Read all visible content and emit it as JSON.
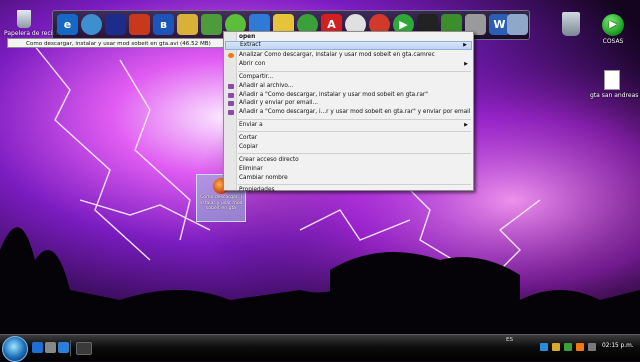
{
  "desktop": {
    "recycle_bin_label": "Papelera de reciclaje",
    "cosas_label": "COSAS",
    "gta_icon_label": "gta san andreas",
    "selected_file_label": "Como descargar, instalar y usar mod sobeit en gta"
  },
  "tooltip": {
    "text": "Como descargar, instalar y usar mod sobeit en gta.avi (46.52 MB)"
  },
  "context_menu": {
    "items": [
      {
        "label": "open",
        "bold": true
      },
      {
        "label": "Extract",
        "submenu": true,
        "highlighted": true
      },
      {
        "label": "Analizar Como descargar, instalar y usar mod sobeit en gta.camrec",
        "icon": "avast-icon"
      },
      {
        "label": "Abrir con",
        "submenu": true
      },
      {
        "label": "Compartir..."
      },
      {
        "label": "Añadir al archivo...",
        "icon": "winrar-icon"
      },
      {
        "label": "Añadir a \"Como descargar, instalar y usar mod sobeit en gta.rar\"",
        "icon": "winrar-icon"
      },
      {
        "label": "Añadir y enviar por email...",
        "icon": "winrar-icon"
      },
      {
        "label": "Añadir a \"Como descargar, i...r y usar mod sobeit en gta.rar\" y enviar por email",
        "icon": "winrar-icon"
      },
      {
        "label": "Enviar a",
        "submenu": true
      },
      {
        "label": "Cortar"
      },
      {
        "label": "Copiar"
      },
      {
        "label": "Crear acceso directo"
      },
      {
        "label": "Eliminar"
      },
      {
        "label": "Cambiar nombre"
      },
      {
        "label": "Propiedades"
      }
    ]
  },
  "taskbar": {
    "language": "ES",
    "clock": "02:15 p.m."
  },
  "colors": {
    "menu_bg": "#f1f1f1",
    "highlight": "#bcd3ef",
    "taskbar": "#0d0d0d"
  }
}
